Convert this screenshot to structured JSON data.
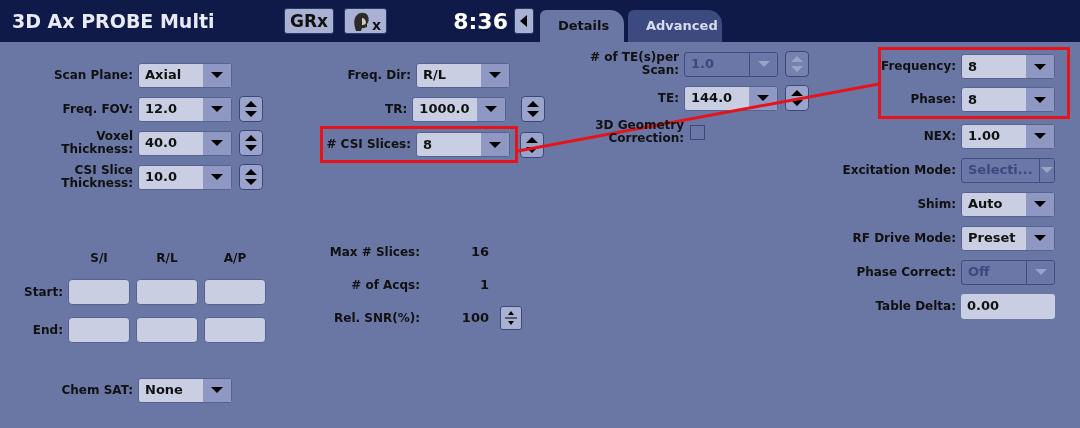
{
  "header": {
    "title": "3D Ax PROBE Multi",
    "buttons": [
      {
        "kind": "text",
        "label": "GRx"
      },
      {
        "kind": "patient",
        "label": "x"
      }
    ],
    "time": "8:36"
  },
  "tabs": [
    {
      "label": "Details",
      "selected": true
    },
    {
      "label": "Advanced",
      "selected": false
    }
  ],
  "left_fields": [
    {
      "label": "Scan Plane:",
      "value": "Axial",
      "kind": "dropdown",
      "spinner": false,
      "disabled": false
    },
    {
      "label": "Freq. FOV:",
      "value": "12.0",
      "kind": "dropdown",
      "spinner": true,
      "disabled": false
    },
    {
      "label": "Voxel Thickness:",
      "value": "40.0",
      "kind": "dropdown",
      "spinner": true,
      "disabled": false
    },
    {
      "label": "CSI Slice Thickness:",
      "value": "10.0",
      "kind": "dropdown",
      "spinner": true,
      "disabled": false
    }
  ],
  "coordinates": {
    "columns": [
      "S/I",
      "R/L",
      "A/P"
    ],
    "rows": [
      {
        "label": "Start:",
        "cells": [
          "",
          "",
          ""
        ]
      },
      {
        "label": "End:",
        "cells": [
          "",
          "",
          ""
        ]
      }
    ]
  },
  "chem_sat": {
    "label": "Chem SAT:",
    "value": "None",
    "kind": "dropdown",
    "disabled": false
  },
  "center_fields": [
    {
      "label": "Freq. Dir:",
      "value": "R/L",
      "kind": "dropdown",
      "spinner": false,
      "disabled": false,
      "highlighted": false
    },
    {
      "label": "TR:",
      "value": "1000.0",
      "kind": "dropdown",
      "spinner": true,
      "disabled": false,
      "highlighted": false
    },
    {
      "label": "# CSI Slices:",
      "value": "8",
      "kind": "dropdown",
      "spinner": true,
      "disabled": false,
      "highlighted": true
    }
  ],
  "info": [
    {
      "label": "Max # Slices:",
      "value": "16",
      "button": false
    },
    {
      "label": "# of Acqs:",
      "value": "1",
      "button": false
    },
    {
      "label": "Rel. SNR(%):",
      "value": "100",
      "button": true
    }
  ],
  "te_fields": [
    {
      "label": "# of TE(s)per Scan:",
      "value": "1.0",
      "kind": "dropdown",
      "spinner": true,
      "disabled": true
    },
    {
      "label": "TE:",
      "value": "144.0",
      "kind": "dropdown",
      "spinner": true,
      "disabled": false
    },
    {
      "label": "3D Geometry Correction:",
      "kind": "checkbox",
      "checked": false
    }
  ],
  "right_fields": [
    {
      "label": "Frequency:",
      "value": "8",
      "kind": "dropdown",
      "disabled": false,
      "highlighted": true
    },
    {
      "label": "Phase:",
      "value": "8",
      "kind": "dropdown",
      "disabled": false,
      "highlighted": true
    },
    {
      "label": "NEX:",
      "value": "1.00",
      "kind": "dropdown",
      "disabled": false,
      "highlighted": false
    },
    {
      "label": "Excitation Mode:",
      "value": "Selecti...",
      "kind": "dropdown",
      "disabled": true,
      "highlighted": false
    },
    {
      "label": "Shim:",
      "value": "Auto",
      "kind": "dropdown",
      "disabled": false,
      "highlighted": false
    },
    {
      "label": "RF Drive Mode:",
      "value": "Preset",
      "kind": "dropdown",
      "disabled": false,
      "highlighted": false
    },
    {
      "label": "Phase Correct:",
      "value": "Off",
      "kind": "dropdown",
      "disabled": true,
      "highlighted": false
    },
    {
      "label": "Table Delta:",
      "value": "0.00",
      "kind": "text",
      "disabled": false,
      "highlighted": false
    }
  ]
}
